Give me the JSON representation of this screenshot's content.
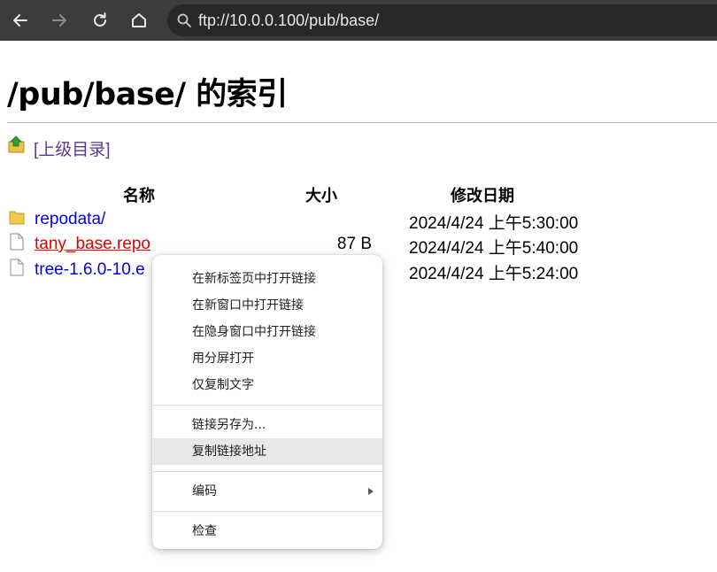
{
  "browser": {
    "url": "ftp://10.0.0.100/pub/base/"
  },
  "page": {
    "title": "/pub/base/ 的索引",
    "parent_link": "[上级目录]",
    "headers": {
      "name": "名称",
      "size": "大小",
      "modified": "修改日期"
    },
    "files": [
      {
        "name": "repodata/",
        "size": "",
        "date": "2024/4/24 上午5:30:00",
        "icon": "folder-icon"
      },
      {
        "name": "tany_base.repo",
        "size": "87 B",
        "date": "2024/4/24 上午5:40:00",
        "icon": "file-icon"
      },
      {
        "name": "tree-1.6.0-10.e",
        "size": "",
        "date": "2024/4/24 上午5:24:00",
        "icon": "file-icon"
      }
    ]
  },
  "context_menu": {
    "items": [
      "在新标签页中打开链接",
      "在新窗口中打开链接",
      "在隐身窗口中打开链接",
      "用分屏打开",
      "仅复制文字",
      "链接另存为...",
      "复制链接地址",
      "编码",
      "检查"
    ]
  },
  "colors": {
    "toolbar": "#3c3c3c",
    "link": "#0000ee",
    "active_link": "#e00000",
    "visited_link": "#5b3a8c"
  }
}
